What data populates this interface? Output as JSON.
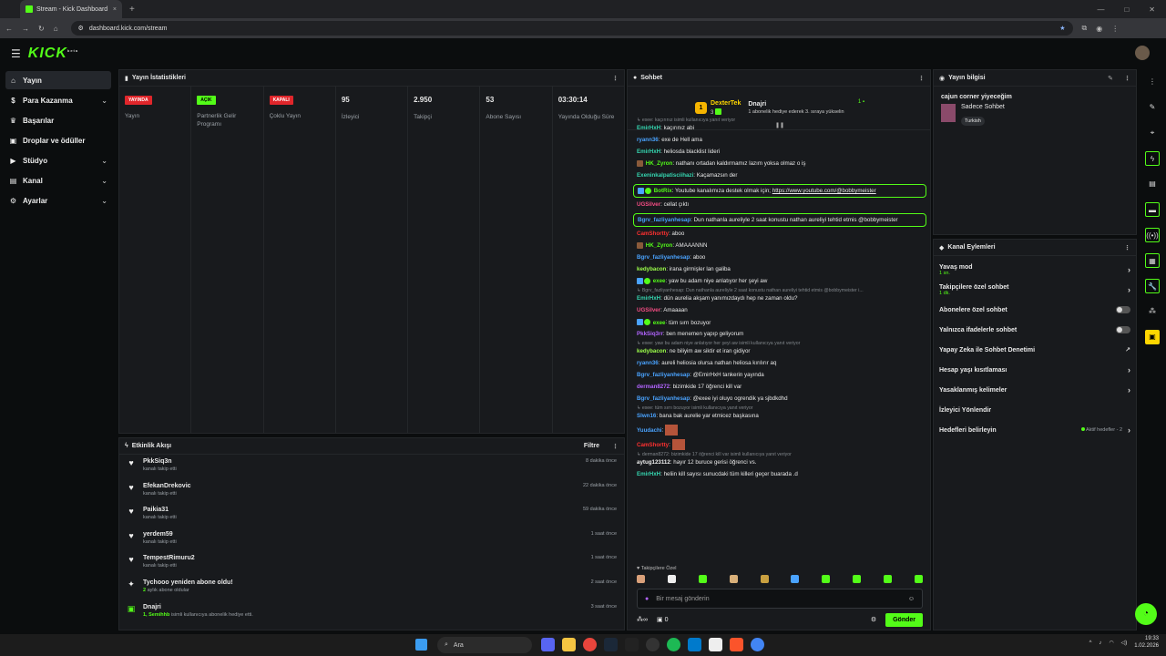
{
  "browser": {
    "tab_title": "Stream - Kick Dashboard",
    "new_tab": "+",
    "url": "dashboard.kick.com/stream"
  },
  "app": {
    "logo": "KICK",
    "logo_sup": "beta"
  },
  "sidebar": {
    "items": [
      {
        "label": "Yayın",
        "icon": "home-icon",
        "active": true,
        "chevron": false
      },
      {
        "label": "Para Kazanma",
        "icon": "money-icon",
        "chevron": true
      },
      {
        "label": "Başarılar",
        "icon": "trophy-icon",
        "chevron": false
      },
      {
        "label": "Droplar ve ödüller",
        "icon": "gift-icon",
        "chevron": false
      },
      {
        "label": "Stüdyo",
        "icon": "studio-icon",
        "chevron": true
      },
      {
        "label": "Kanal",
        "icon": "channel-icon",
        "chevron": true
      },
      {
        "label": "Ayarlar",
        "icon": "gear-icon",
        "chevron": true
      }
    ]
  },
  "stats": {
    "title": "Yayın İstatistikleri",
    "columns": [
      {
        "badge": "YAYINDA",
        "badge_color": "red",
        "label": "Yayın"
      },
      {
        "badge": "AÇIK",
        "badge_color": "green",
        "label": "Partnerlik Gelir Programı"
      },
      {
        "badge": "KAPALI",
        "badge_color": "red",
        "label": "Çoklu Yayın"
      },
      {
        "value": "95",
        "label": "İzleyici"
      },
      {
        "value": "2.950",
        "label": "Takipçi"
      },
      {
        "value": "53",
        "label": "Abone Sayısı"
      },
      {
        "value": "03:30:14",
        "label": "Yayında Olduğu Süre"
      }
    ]
  },
  "activity": {
    "title": "Etkinlik Akışı",
    "filter": "Filtre",
    "items": [
      {
        "name": "PkkSiq3n",
        "sub": "kanalı takip etti",
        "time": "8 dakika önce",
        "icon": "heart-icon"
      },
      {
        "name": "EfekanDrekovic",
        "sub": "kanalı takip etti",
        "time": "22 dakika önce",
        "icon": "heart-icon"
      },
      {
        "name": "Paikia31",
        "sub": "kanalı takip etti",
        "time": "59 dakika önce",
        "icon": "heart-icon"
      },
      {
        "name": "yerdem59",
        "sub": "kanalı takip etti",
        "time": "1 saat önce",
        "icon": "heart-icon"
      },
      {
        "name": "TempestRimuru2",
        "sub": "kanalı takip etti",
        "time": "1 saat önce",
        "icon": "heart-icon"
      },
      {
        "name": "Tychooo yeniden abone oldu!",
        "sub_green": "2",
        "sub": "aylık abone oldular",
        "time": "2 saat önce",
        "icon": "sparkle-icon"
      },
      {
        "name": "Dnajri",
        "sub_green": "1, Semihhb",
        "sub": "isimli kullanıcıya abonelik hediye etti.",
        "time": "3 saat önce",
        "icon": "gift-icon"
      }
    ]
  },
  "chat": {
    "title": "Sohbet",
    "sub_leader": {
      "name": "DexterTek",
      "count": "3"
    },
    "sub_second": {
      "name": "Dnajri",
      "note": "1 abonelik hediye ederek 3. sıraya yükselin",
      "count": "1"
    },
    "messages": [
      {
        "type": "reply",
        "text": "exee: kaçırınız isimli kullanıcıya yanıt veriyor"
      },
      {
        "type": "msg",
        "user": "EmirHxH",
        "color": "teal",
        "text": "kaçırınız abi"
      },
      {
        "type": "msg",
        "user": "ryann36",
        "color": "blue",
        "text": "exe de Hell ama"
      },
      {
        "type": "msg",
        "user": "EmirHxH",
        "color": "teal",
        "text": "heliosda blacklist lideri"
      },
      {
        "type": "msg",
        "user": "HK_Zyron",
        "color": "green",
        "text": "nathanı ortadan kaldırmamız lazım yoksa olmaz o iş"
      },
      {
        "type": "msg",
        "user": "Exeninkalpatisciihazi",
        "color": "teal",
        "text": "Kaçamazsın der"
      },
      {
        "type": "hl",
        "user": "BotRix",
        "color": "green",
        "text": "Youtube kanalımıza destek olmak için; ",
        "link": "https://www.youtube.com/@bobbymeister"
      },
      {
        "type": "msg",
        "user": "UGSilver",
        "color": "pink",
        "text": "cellat çıktı"
      },
      {
        "type": "hl",
        "user": "Bgrv_fazliyanhesap",
        "color": "blue",
        "text": "Dun nathanla aureliyle 2 saat konustu nathan aureliyi tehtid etmis @bobbymeister"
      },
      {
        "type": "msg",
        "user": "CamShortty",
        "color": "red",
        "text": "aboo"
      },
      {
        "type": "msg",
        "user": "HK_Zyron",
        "color": "green",
        "text": "AMAAANNN"
      },
      {
        "type": "msg",
        "user": "Bgrv_fazliyanhesap",
        "color": "blue",
        "text": "aboo"
      },
      {
        "type": "msg",
        "user": "kedybacon",
        "color": "lime",
        "text": "irana girmişler lan galiba"
      },
      {
        "type": "msg",
        "user": "exee",
        "color": "green",
        "text": "yaw bu adam niye anlatıyor her şeyi aw"
      },
      {
        "type": "reply",
        "text": "Bgrv_fazliyanhesap: Dun nathanla aureliyle 2 saat konustu nathan aureliyi tehtid etmis @bobbymeister i..."
      },
      {
        "type": "msg",
        "user": "EmirHxH",
        "color": "teal",
        "text": "dün aurelia akşam yanımızdaydı hep ne zaman oldu?"
      },
      {
        "type": "msg",
        "user": "UGSilver",
        "color": "pink",
        "text": "Amaaaan"
      },
      {
        "type": "msg",
        "user": "exee",
        "color": "green",
        "text": "tüm sırrı bozuyor"
      },
      {
        "type": "msg",
        "user": "PkkSiq3rr",
        "color": "purple",
        "text": "ben menemen yapıp geliyorum"
      },
      {
        "type": "reply",
        "text": "exee: yaw bu adam niye anlatıyor her şeyi aw isimli kullanıcıya yanıt veriyor"
      },
      {
        "type": "msg",
        "user": "kedybacon",
        "color": "lime",
        "text": "ne biliyim aw siktir et iran gidiyor"
      },
      {
        "type": "msg",
        "user": "ryann36",
        "color": "blue",
        "text": "aureli heliosia olursa nathan heliosa kırılırır aq"
      },
      {
        "type": "msg",
        "user": "Bgrv_fazliyanhesap",
        "color": "blue",
        "text": "@EmirHxH tankerin yayında"
      },
      {
        "type": "msg",
        "user": "derman8272",
        "color": "purple",
        "text": "bizimkide 17 öğrenci kill var"
      },
      {
        "type": "msg",
        "user": "Bgrv_fazliyanhesap",
        "color": "blue",
        "text": "@exee iyi oluyo ogrendik ya sjbdkdhd"
      },
      {
        "type": "reply",
        "text": "exee: tüm sırrı bozuyor isimli kullanıcıya yanıt veriyor"
      },
      {
        "type": "msg",
        "user": "Slwn16",
        "color": "blue",
        "text": "bana bak aurelie yar etmicez başkasına"
      },
      {
        "type": "img",
        "user": "Yuudachi",
        "color": "blue"
      },
      {
        "type": "img",
        "user": "CamShortty",
        "color": "red"
      },
      {
        "type": "reply",
        "text": "derman8272: bizimkide 17 öğrenci kill var isimli kullanıcıya yanıt veriyor"
      },
      {
        "type": "msg",
        "user": "aytug123112",
        "color": "white",
        "text": "hayır 12 buruce gerisi öğrenci vs."
      },
      {
        "type": "msg",
        "user": "EmirHxH",
        "color": "teal",
        "text": "heliin kill sayısı sunucdaki tüm killeri geçer buarada .d"
      }
    ],
    "emote_label": "Takipçilere Özel",
    "input_placeholder": "Bir mesaj gönderin",
    "points": "∞",
    "count": "0",
    "send": "Gönder"
  },
  "stream_info": {
    "title": "Yayın bilgisi",
    "stream_title": "cajun corner yiyeceğim",
    "category": "Sadece Sohbet",
    "tag": "Turkish"
  },
  "channel_actions": {
    "title": "Kanal Eylemleri",
    "items": [
      {
        "label": "Yavaş mod",
        "sub": "1 sn.",
        "control": "chevron"
      },
      {
        "label": "Takipçilere özel sohbet",
        "sub": "1 dk.",
        "control": "chevron"
      },
      {
        "label": "Abonelere özel sohbet",
        "control": "toggle"
      },
      {
        "label": "Yalnızca ifadelerle sohbet",
        "control": "toggle"
      },
      {
        "label": "Yapay Zeka ile Sohbet Denetimi",
        "control": "ext"
      },
      {
        "label": "Hesap yaşı kısıtlaması",
        "control": "chevron"
      },
      {
        "label": "Yasaklanmış kelimeler",
        "control": "chevron"
      },
      {
        "label": "İzleyici Yönlendir",
        "control": "none"
      },
      {
        "label": "Hedefleri belirleyin",
        "aktif": "Aktif hedefler - 2",
        "control": "chevron"
      }
    ]
  },
  "taskbar": {
    "search": "Ara",
    "time": "19:33",
    "date": "1.02.2026"
  },
  "colors": {
    "accent": "#53fc18",
    "live": "#e0262b",
    "panel": "#181a1d"
  }
}
